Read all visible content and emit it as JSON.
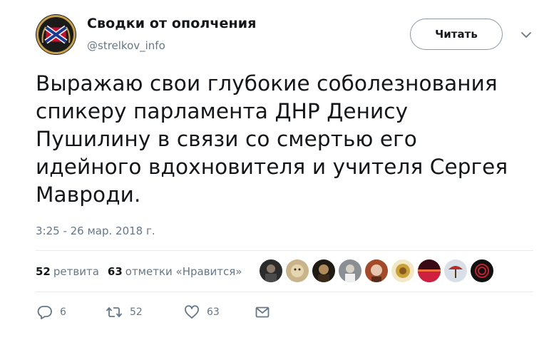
{
  "author": {
    "name": "Сводки от ополчения",
    "handle": "@strelkov_info"
  },
  "follow_button": {
    "label": "Читать"
  },
  "tweet": {
    "lines": [
      "Выражаю свои глубокие соболезнования",
      "спикеру парламента ДНР Денису",
      "Пушилину в связи со смертью его",
      "идейного вдохновителя и учителя Сергея",
      "Мавроди."
    ],
    "timestamp": "3:25 - 26 мар. 2018 г."
  },
  "stats": {
    "retweets_count": "52",
    "retweets_label": "ретвита",
    "likes_count": "63",
    "likes_label": "отметки «Нравится»"
  },
  "actions": {
    "reply_count": "6",
    "retweet_count": "52",
    "like_count": "63"
  },
  "icons": {
    "caret": "chevron-down-icon",
    "reply": "reply-icon",
    "retweet": "retweet-icon",
    "like": "heart-icon",
    "dm": "envelope-icon"
  },
  "colors": {
    "text": "#14171a",
    "secondary": "#657786",
    "border": "#e6ecf0",
    "flag_red": "#c8102e",
    "flag_blue": "#1f3a93"
  }
}
